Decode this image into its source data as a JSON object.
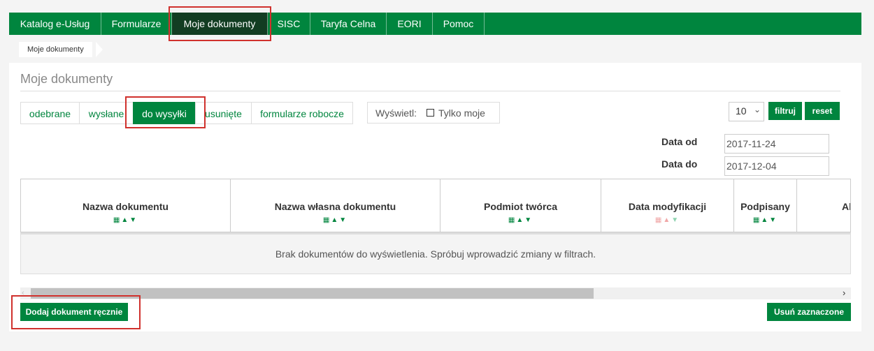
{
  "nav": {
    "items": [
      "Katalog e-Usług",
      "Formularze",
      "Moje dokumenty",
      "SISC",
      "Taryfa Celna",
      "EORI",
      "Pomoc"
    ],
    "active": "Moje dokumenty"
  },
  "breadcrumb": "Moje dokumenty",
  "page_title": "Moje dokumenty",
  "tabs": [
    "odebrane",
    "wysłane",
    "do wysyłki",
    "usunięte",
    "formularze robocze"
  ],
  "filter": {
    "show_label": "Wyświetl:",
    "only_mine_label": "Tylko moje",
    "only_mine_checked": false,
    "page_size": "10",
    "filter_button": "filtruj",
    "reset_button": "reset"
  },
  "dates": {
    "from_label": "Data od",
    "from_value": "2017-11-24",
    "to_label": "Data do",
    "to_value": "2017-12-04"
  },
  "table": {
    "columns": [
      "Nazwa dokumentu",
      "Nazwa własna dokumentu",
      "Podmiot twórca",
      "Data modyfikacji",
      "Podpisany",
      "Ak"
    ],
    "empty_message": "Brak dokumentów do wyświetlenia. Spróbuj wprowadzić zmiany w filtrach."
  },
  "actions": {
    "add_manual": "Dodaj dokument ręcznie",
    "delete_selected": "Usuń zaznaczone"
  },
  "colors": {
    "brand_green": "#00853e",
    "nav_active": "#123d22",
    "highlight_red": "#d0312d"
  }
}
